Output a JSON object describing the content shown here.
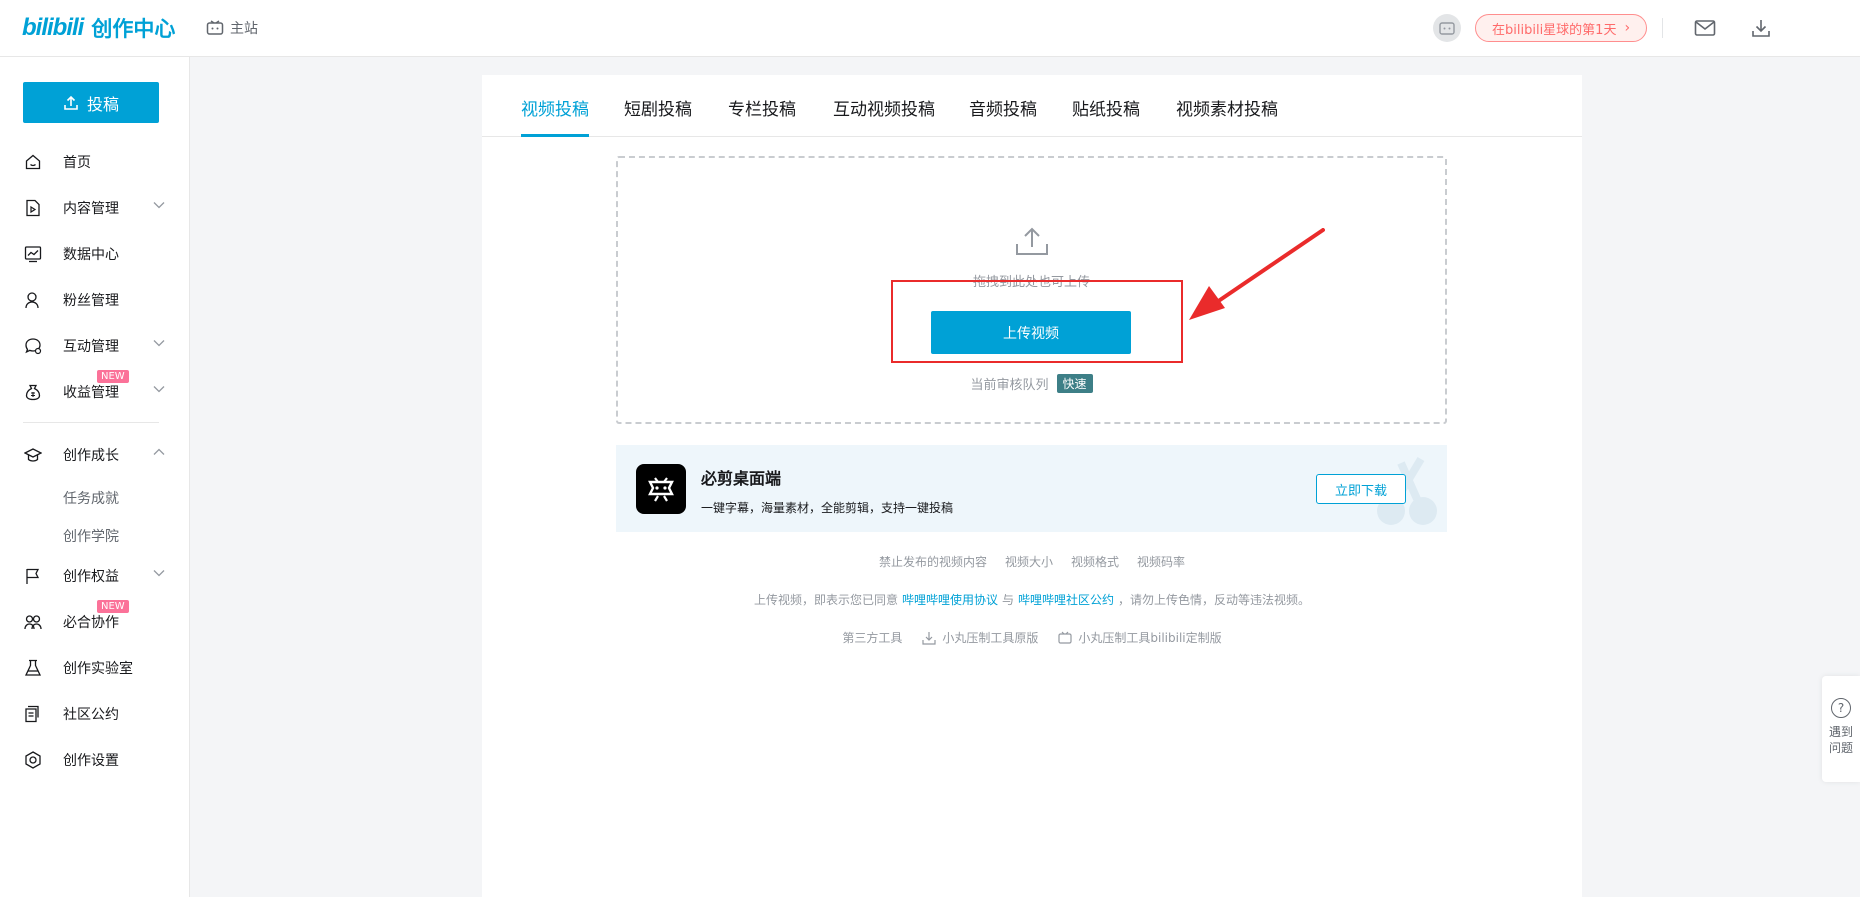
{
  "header": {
    "logo_bili": "bilibili",
    "logo_title": "创作中心",
    "main_site": "主站",
    "planet_text": "在bilibili星球的第1天",
    "icons": [
      "tv-icon",
      "avatar-icon",
      "mail-icon",
      "download-icon"
    ]
  },
  "sidebar": {
    "upload_label": "投稿",
    "items": [
      {
        "label": "首页",
        "icon": "home-icon"
      },
      {
        "label": "内容管理",
        "icon": "content-icon"
      },
      {
        "label": "数据中心",
        "icon": "chart-icon"
      },
      {
        "label": "粉丝管理",
        "icon": "fans-icon"
      },
      {
        "label": "互动管理",
        "icon": "chat-icon"
      },
      {
        "label": "收益管理",
        "icon": "money-icon",
        "badge": "NEW"
      },
      {
        "label": "创作成长",
        "icon": "cap-icon"
      },
      {
        "label": "任务成就"
      },
      {
        "label": "创作学院"
      },
      {
        "label": "创作权益",
        "icon": "flag-icon"
      },
      {
        "label": "必合协作",
        "icon": "team-icon",
        "badge": "NEW"
      },
      {
        "label": "创作实验室",
        "icon": "flask-icon"
      },
      {
        "label": "社区公约",
        "icon": "scroll-icon"
      },
      {
        "label": "创作设置",
        "icon": "settings-icon"
      }
    ]
  },
  "tabs": [
    "视频投稿",
    "短剧投稿",
    "专栏投稿",
    "互动视频投稿",
    "音频投稿",
    "贴纸投稿",
    "视频素材投稿"
  ],
  "upload": {
    "hint": "拖拽到此处也可上传",
    "button": "上传视频",
    "queue_label": "当前审核队列",
    "queue_status": "快速"
  },
  "promo": {
    "title": "必剪桌面端",
    "desc": "一键字幕，海量素材，全能剪辑，支持一键投稿",
    "button": "立即下载"
  },
  "links": [
    "禁止发布的视频内容",
    "视频大小",
    "视频格式",
    "视频码率"
  ],
  "agreement": {
    "prefix": "上传视频，即表示您已同意",
    "link1": "哔哩哔哩使用协议",
    "mid": "与",
    "link2": "哔哩哔哩社区公约",
    "suffix": "，请勿上传色情，反动等违法视频。"
  },
  "tools": {
    "label": "第三方工具",
    "tool1": "小丸压制工具原版",
    "tool2": "小丸压制工具bilibili定制版"
  },
  "help": {
    "text": "遇到问题"
  },
  "colors": {
    "brand": "#00a1d6",
    "annotation": "#ea2b2b",
    "badge": "#fb7299"
  }
}
